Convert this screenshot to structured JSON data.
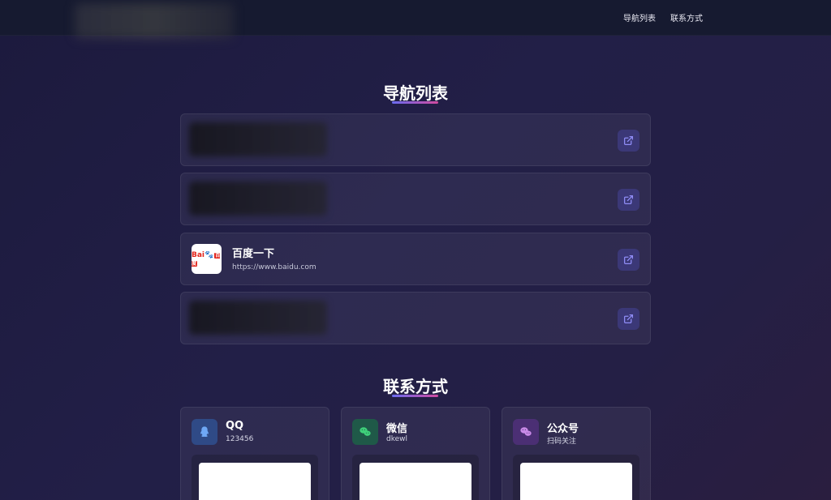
{
  "header": {
    "nav": [
      {
        "label": "导航列表"
      },
      {
        "label": "联系方式"
      }
    ]
  },
  "nav_section": {
    "title": "导航列表",
    "items": [
      {
        "name": "",
        "url": ""
      },
      {
        "name": "",
        "url": ""
      },
      {
        "name": "百度一下",
        "url": "https://www.baidu.com"
      },
      {
        "name": "",
        "url": ""
      }
    ]
  },
  "contact_section": {
    "title": "联系方式",
    "items": [
      {
        "title": "QQ",
        "sub": "123456",
        "icon": "qq-icon",
        "color": "#6fa8f5",
        "bg": "#2f4a86"
      },
      {
        "title": "微信",
        "sub": "dkewl",
        "icon": "wechat-icon",
        "color": "#3fd07a",
        "bg": "#1f5948"
      },
      {
        "title": "公众号",
        "sub": "扫码关注",
        "icon": "wechat-official-icon",
        "color": "#c98be8",
        "bg": "#4b2f74"
      }
    ]
  },
  "colors": {
    "accent_start": "#6a6cf0",
    "accent_end": "#d04a9f"
  }
}
